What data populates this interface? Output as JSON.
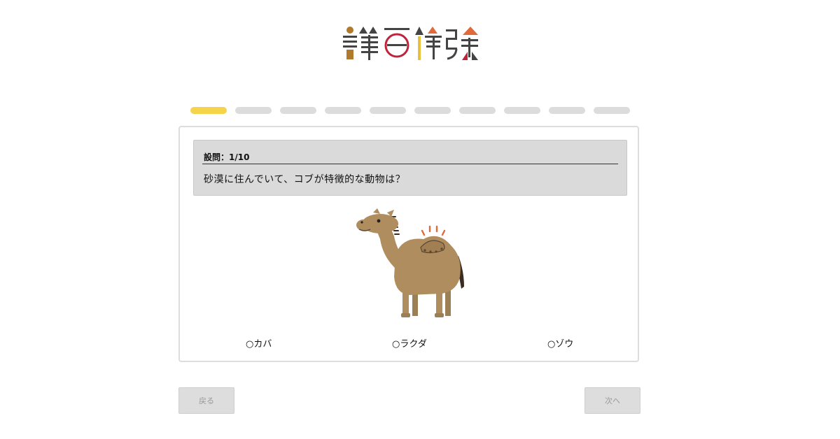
{
  "logo": {
    "text": "謎百傑強",
    "colors": [
      "#b07a2c",
      "#444444",
      "#c0243a",
      "#e8c040",
      "#e06a3a"
    ]
  },
  "progress": {
    "total_steps": 10,
    "current_step": 1,
    "active_color": "#f5d34a",
    "inactive_color": "#dcdcdc"
  },
  "question": {
    "number_label": "設問：1/10",
    "text": "砂漠に住んでいて、コブが特徴的な動物は？",
    "image": "camel-illustration"
  },
  "options": [
    {
      "label": "○カバ"
    },
    {
      "label": "○ラクダ"
    },
    {
      "label": "○ゾウ"
    }
  ],
  "nav": {
    "back_label": "戻る",
    "next_label": "次へ"
  }
}
